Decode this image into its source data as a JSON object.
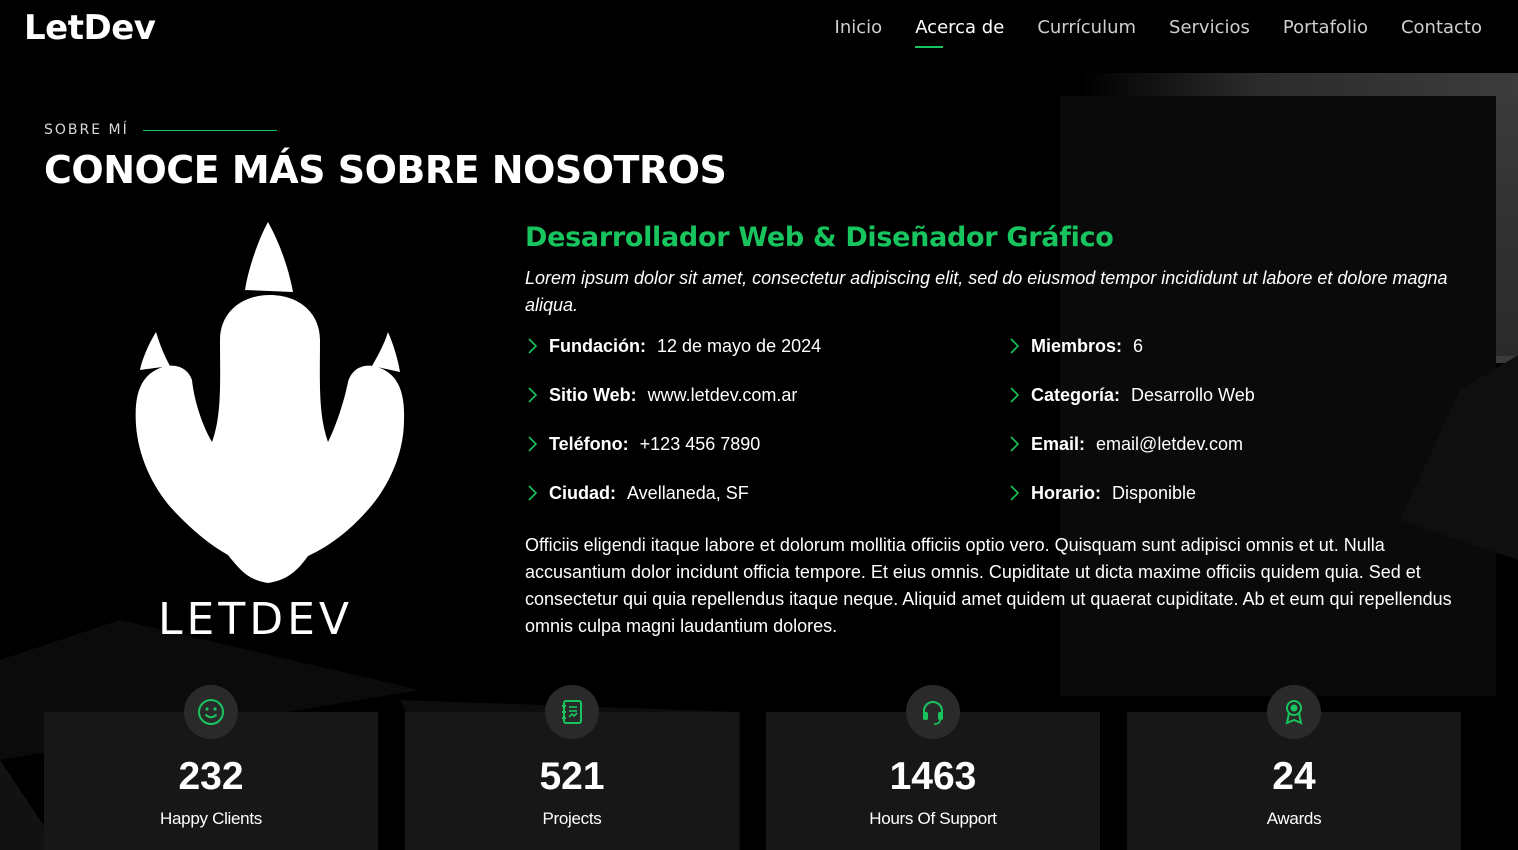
{
  "brand": {
    "logo": "LetDev",
    "art_wordmark": "LETDEV"
  },
  "nav": {
    "items": [
      {
        "label": "Inicio"
      },
      {
        "label": "Acerca de",
        "active": true
      },
      {
        "label": "Currículum"
      },
      {
        "label": "Servicios"
      },
      {
        "label": "Portafolio"
      },
      {
        "label": "Contacto"
      }
    ]
  },
  "about": {
    "eyebrow": "SOBRE MÍ",
    "title": "CONOCE MÁS SOBRE NOSOTROS",
    "role": "Desarrollador Web & Diseñador Gráfico",
    "lead": "Lorem ipsum dolor sit amet, consectetur adipiscing elit, sed do eiusmod tempor incididunt ut labore et dolore magna aliqua.",
    "info": [
      {
        "key": "Fundación:",
        "value": "12 de mayo de 2024"
      },
      {
        "key": "Miembros:",
        "value": "6"
      },
      {
        "key": "Sitio Web:",
        "value": "www.letdev.com.ar"
      },
      {
        "key": "Categoría:",
        "value": "Desarrollo Web"
      },
      {
        "key": "Teléfono:",
        "value": "+123 456 7890"
      },
      {
        "key": "Email:",
        "value": "email@letdev.com"
      },
      {
        "key": "Ciudad:",
        "value": "Avellaneda, SF"
      },
      {
        "key": "Horario:",
        "value": "Disponible"
      }
    ],
    "body": "Officiis eligendi itaque labore et dolorum mollitia officiis optio vero. Quisquam sunt adipisci omnis et ut. Nulla accusantium dolor incidunt officia tempore. Et eius omnis. Cupiditate ut dicta maxime officiis quidem quia. Sed et consectetur qui quia repellendus itaque neque. Aliquid amet quidem ut quaerat cupiditate. Ab et eum qui repellendus omnis culpa magni laudantium dolores."
  },
  "stats": [
    {
      "icon": "smiley-icon",
      "value": "232",
      "label": "Happy Clients"
    },
    {
      "icon": "journal-icon",
      "value": "521",
      "label": "Projects"
    },
    {
      "icon": "headset-icon",
      "value": "1463",
      "label": "Hours Of Support"
    },
    {
      "icon": "award-icon",
      "value": "24",
      "label": "Awards"
    }
  ],
  "colors": {
    "accent": "#18c45d",
    "background": "#000000",
    "card": "#171717"
  }
}
